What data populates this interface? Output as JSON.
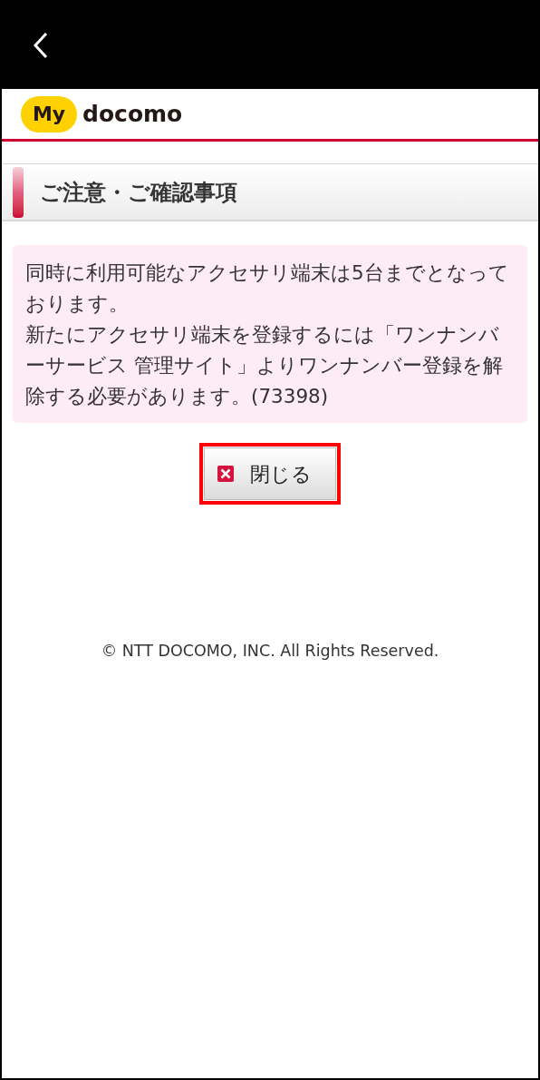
{
  "logo": {
    "badge": "My",
    "wordmark": "docomo"
  },
  "section_title": "ご注意・ご確認事項",
  "message": [
    "同時に利用可能なアクセサリ端末は5台までとなっております。",
    "新たにアクセサリ端末を登録するには「ワンナンバーサービス 管理サイト」よりワンナンバー登録を解除する必要があります。(73398)"
  ],
  "close_button": {
    "label": "閉じる",
    "highlighted": true
  },
  "footer": "© NTT DOCOMO, INC. All Rights Reserved."
}
